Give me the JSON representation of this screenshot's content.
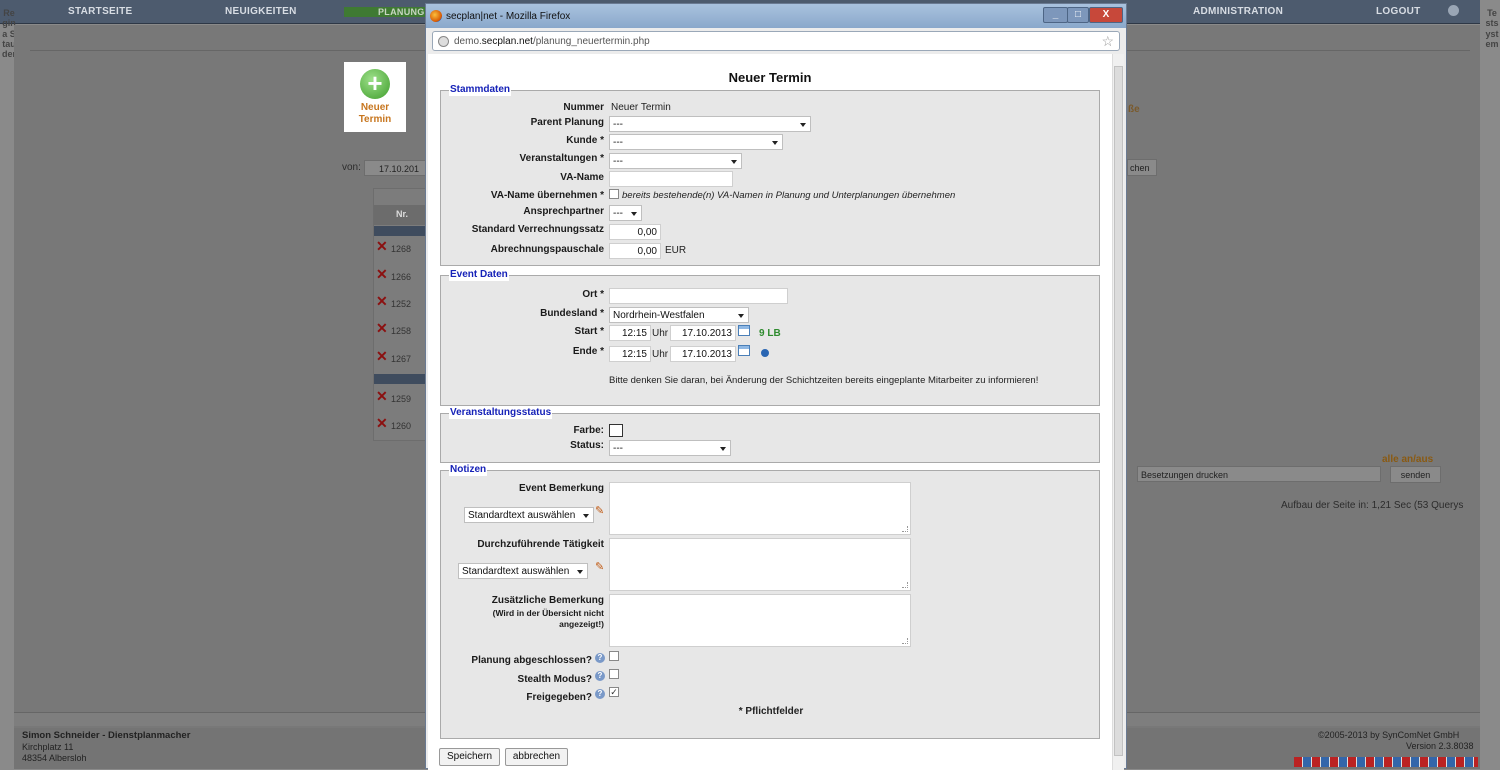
{
  "background": {
    "nav": [
      "STARTSEITE",
      "NEUIGKEITEN",
      "PLANUNG",
      "ADMINISTRATION",
      "LOGOUT"
    ],
    "left_vertical": "Regina Stauder",
    "right_vertical": "Testsystem",
    "new_button": {
      "line1": "Neuer",
      "line2": "Termin"
    },
    "right_partial": "ße",
    "von_label": "von:",
    "von_date": "17.10.201",
    "search_partial": "chen",
    "table_header_nr": "Nr.",
    "rows": [
      "1268",
      "1266",
      "1252",
      "1258",
      "1267",
      "1259",
      "1260"
    ],
    "alle_an_aus": "alle an/aus",
    "print_select": "Besetzungen drucken",
    "send_button": "senden",
    "load_time": "Aufbau der Seite in: 1,21 Sec (53 Querys",
    "footer_name": "Simon Schneider - Dienstplanmacher",
    "footer_street": "Kirchplatz 11",
    "footer_city": "48354 Albersloh",
    "footer_copyright": "©2005-2013 by SynComNet GmbH",
    "footer_version": "Version 2.3.8038"
  },
  "window": {
    "title": "secplan|net - Mozilla Firefox",
    "url_prefix": "demo.",
    "url_domain": "secplan.net",
    "url_path": "/planung_neuertermin.php",
    "btn_min": "_",
    "btn_max": "□",
    "btn_close": "X",
    "star": "☆"
  },
  "form": {
    "title": "Neuer Termin",
    "stammdaten": {
      "legend": "Stammdaten",
      "nummer_label": "Nummer",
      "nummer_value": "Neuer Termin",
      "parent_label": "Parent Planung",
      "parent_value": "---",
      "kunde_label": "Kunde *",
      "kunde_value": "---",
      "veranstaltungen_label": "Veranstaltungen *",
      "veranstaltungen_value": "---",
      "vaname_label": "VA-Name",
      "vaname_value": "",
      "vaname_uebernehmen_label": "VA-Name übernehmen *",
      "vaname_uebernehmen_text": "bereits bestehende(n) VA-Namen in Planung und Unterplanungen übernehmen",
      "ansprechpartner_label": "Ansprechpartner",
      "ansprechpartner_value": "---",
      "verrechnungssatz_label": "Standard Verrechnungssatz",
      "verrechnungssatz_value": "0,00",
      "pauschale_label": "Abrechnungspauschale",
      "pauschale_value": "0,00",
      "pauschale_unit": "EUR"
    },
    "event": {
      "legend": "Event Daten",
      "ort_label": "Ort *",
      "ort_value": "",
      "bundesland_label": "Bundesland *",
      "bundesland_value": "Nordrhein-Westfalen",
      "start_label": "Start *",
      "start_time": "12:15",
      "start_unit": "Uhr",
      "start_date": "17.10.2013",
      "start_note": "9 LB",
      "ende_label": "Ende *",
      "ende_time": "12:15",
      "ende_unit": "Uhr",
      "ende_date": "17.10.2013",
      "hint": "Bitte denken Sie daran, bei Änderung der Schichtzeiten bereits eingeplante Mitarbeiter zu informieren!"
    },
    "status": {
      "legend": "Veranstaltungsstatus",
      "farbe_label": "Farbe:",
      "status_label": "Status:",
      "status_value": "---"
    },
    "notizen": {
      "legend": "Notizen",
      "event_bemerkung_label": "Event Bemerkung",
      "standardtext1": "Standardtext auswählen",
      "taetigkeit_label": "Durchzuführende Tätigkeit",
      "standardtext2": "Standardtext auswählen",
      "zusaetzlich_label": "Zusätzliche Bemerkung",
      "zusaetzlich_sub1": "(Wird in der Übersicht nicht",
      "zusaetzlich_sub2": "angezeigt!)",
      "abgeschlossen_label": "Planung abgeschlossen?",
      "stealth_label": "Stealth Modus?",
      "freigegeben_label": "Freigegeben?",
      "pflicht": "* Pflichtfelder"
    },
    "save_button": "Speichern",
    "cancel_button": "abbrechen"
  }
}
